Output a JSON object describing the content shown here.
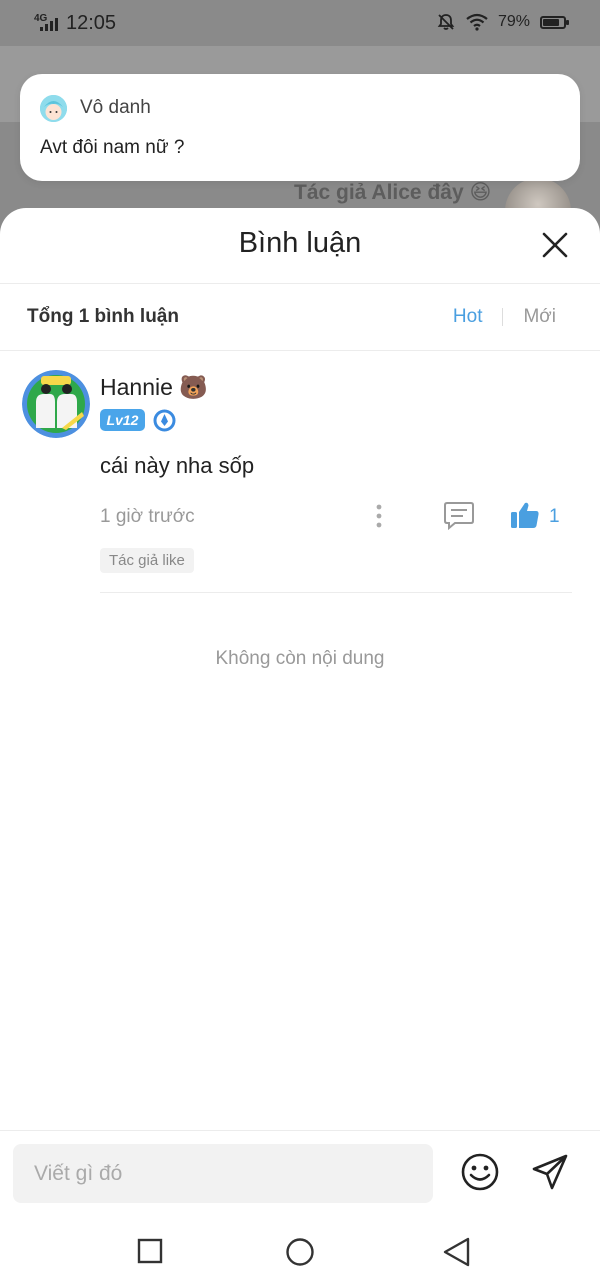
{
  "status_bar": {
    "network": "4G",
    "time": "12:05",
    "battery": "79%",
    "battery_level": 0.79
  },
  "background": {
    "author_text": "Tác giả Alice đây 😆"
  },
  "toast": {
    "user_name": "Vô danh",
    "message": "Avt đôi nam nữ ?"
  },
  "sheet": {
    "title": "Bình luận",
    "total_label": "Tổng 1 bình luận",
    "sort_tabs": [
      {
        "label": "Hot",
        "active": true
      },
      {
        "label": "Mới",
        "active": false
      }
    ]
  },
  "comments": [
    {
      "user_name": "Hannie 🐻",
      "level": "Lv12",
      "text": "cái này nha sốp",
      "time": "1 giờ trước",
      "like_count": "1",
      "tag": "Tác giả like"
    }
  ],
  "end_message": "Không còn nội dung",
  "composer": {
    "placeholder": "Viết gì đó"
  },
  "colors": {
    "accent": "#4a9fe0",
    "level_badge": "#4aa5ea"
  }
}
